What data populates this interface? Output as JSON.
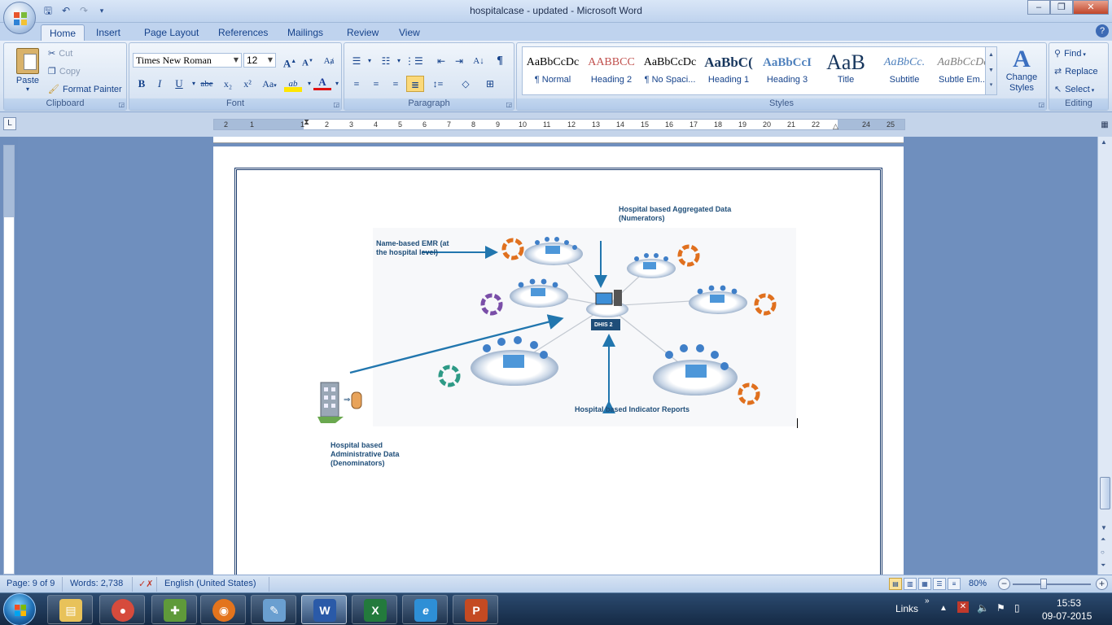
{
  "window": {
    "title": "hospitalcase - updated - Microsoft Word",
    "controls": {
      "minimize": "–",
      "restore": "❐",
      "close": "✕"
    }
  },
  "qat": {
    "save_icon": "save-icon",
    "undo_icon": "undo-icon",
    "redo_icon": "redo-icon"
  },
  "tabs": [
    {
      "label": "Home"
    },
    {
      "label": "Insert"
    },
    {
      "label": "Page Layout"
    },
    {
      "label": "References"
    },
    {
      "label": "Mailings"
    },
    {
      "label": "Review"
    },
    {
      "label": "View"
    }
  ],
  "ribbon": {
    "clipboard": {
      "label": "Clipboard",
      "paste": "Paste",
      "cut": "Cut",
      "copy": "Copy",
      "format_painter": "Format Painter"
    },
    "font": {
      "label": "Font",
      "font_name": "Times New Roman",
      "font_size": "12",
      "grow": "A",
      "shrink": "A",
      "bold": "B",
      "italic": "I",
      "underline": "U",
      "strike": "abe",
      "subscript": "x₂",
      "superscript": "x²",
      "change_case": "Aa",
      "highlight": "ab",
      "font_color": "A"
    },
    "paragraph": {
      "label": "Paragraph"
    },
    "styles": {
      "label": "Styles",
      "items": [
        {
          "sample": "AaBbCcDc",
          "name": "¶ Normal"
        },
        {
          "sample": "AABBCC",
          "name": "Heading 2"
        },
        {
          "sample": "AaBbCcDc",
          "name": "¶ No Spaci..."
        },
        {
          "sample": "AaBbC(",
          "name": "Heading 1"
        },
        {
          "sample": "AaBbCcI",
          "name": "Heading 3"
        },
        {
          "sample": "AaB",
          "name": "Title"
        },
        {
          "sample": "AaBbCc.",
          "name": "Subtitle"
        },
        {
          "sample": "AaBbCcDc",
          "name": "Subtle Em..."
        }
      ],
      "change_styles": "Change Styles"
    },
    "editing": {
      "label": "Editing",
      "find": "Find",
      "replace": "Replace",
      "select": "Select"
    }
  },
  "ruler": {
    "numbers": [
      "2",
      "1",
      "1",
      "1",
      "2",
      "3",
      "4",
      "5",
      "6",
      "7",
      "8",
      "9",
      "10",
      "11",
      "12",
      "13",
      "14",
      "15",
      "16",
      "17",
      "18",
      "19",
      "20",
      "21",
      "22",
      "24",
      "25"
    ]
  },
  "document": {
    "labels": {
      "aggregated": "Hospital based  Aggregated Data (Numerators)",
      "emr": "Name-based EMR (at the hospital level)",
      "indicator": "Hospital based  Indicator Reports",
      "administrative": "Hospital based Administrative Data (Denominators)"
    },
    "hub_label": "DHIS 2"
  },
  "statusbar": {
    "page": "Page: 9 of 9",
    "words": "Words: 2,738",
    "language": "English (United States)",
    "zoom": "80%"
  },
  "taskbar": {
    "apps": [
      {
        "name": "explorer",
        "glyph": "▤",
        "color": "#e8c25a"
      },
      {
        "name": "chrome",
        "glyph": "●",
        "color": "#d64b3c"
      },
      {
        "name": "tool",
        "glyph": "✚",
        "color": "#5f9a3a"
      },
      {
        "name": "firefox",
        "glyph": "◉",
        "color": "#e3741d"
      },
      {
        "name": "notes",
        "glyph": "✎",
        "color": "#6a9fd0"
      },
      {
        "name": "word",
        "glyph": "W",
        "color": "#2a5aa8"
      },
      {
        "name": "excel",
        "glyph": "X",
        "color": "#237a3c"
      },
      {
        "name": "ie",
        "glyph": "e",
        "color": "#2e8fd6"
      },
      {
        "name": "powerpoint",
        "glyph": "P",
        "color": "#c44a22"
      }
    ],
    "links": "Links",
    "time": "15:53",
    "date": "09-07-2015"
  }
}
